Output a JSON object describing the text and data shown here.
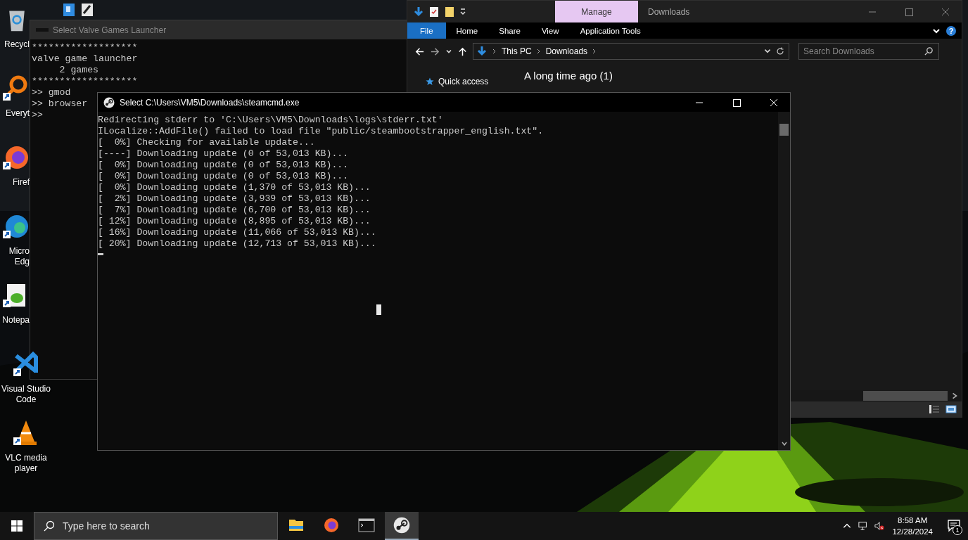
{
  "desktop_icons": [
    {
      "kind": "recycle-bin",
      "label": "Recycl"
    },
    {
      "kind": "everything",
      "label": "Everyt"
    },
    {
      "kind": "firefox",
      "label": "Firef"
    },
    {
      "kind": "edge",
      "label": "Micro Edg"
    },
    {
      "kind": "notepad",
      "label": "Notepa"
    },
    {
      "kind": "vscode",
      "label": "Visual Studio Code"
    },
    {
      "kind": "vlc",
      "label": "VLC media player"
    }
  ],
  "launcher_window": {
    "title": "Select Valve Games Launcher",
    "lines": [
      "*******************",
      "valve game launcher",
      "     2 games",
      "*******************",
      ">> gmod",
      ">> browser",
      ">>"
    ]
  },
  "explorer_window": {
    "context_tab": "Manage",
    "title": "Downloads",
    "ribbon_tabs": [
      {
        "label": "File",
        "selected": true
      },
      {
        "label": "Home",
        "selected": false
      },
      {
        "label": "Share",
        "selected": false
      },
      {
        "label": "View",
        "selected": false
      },
      {
        "label": "Application Tools",
        "selected": false
      }
    ],
    "help": "?",
    "breadcrumb": [
      "This PC",
      "Downloads"
    ],
    "search": {
      "placeholder": "Search Downloads"
    },
    "nav_items": [
      "Quick access"
    ],
    "group_heading": "A long time ago (1)"
  },
  "steamcmd_window": {
    "title": "Select C:\\Users\\VM5\\Downloads\\steamcmd.exe",
    "lines": [
      "Redirecting stderr to 'C:\\Users\\VM5\\Downloads\\logs\\stderr.txt'",
      "ILocalize::AddFile() failed to load file \"public/steambootstrapper_english.txt\".",
      "[  0%] Checking for available update...",
      "[----] Downloading update (0 of 53,013 KB)...",
      "[  0%] Downloading update (0 of 53,013 KB)...",
      "[  0%] Downloading update (0 of 53,013 KB)...",
      "[  0%] Downloading update (1,370 of 53,013 KB)...",
      "[  2%] Downloading update (3,939 of 53,013 KB)...",
      "[  7%] Downloading update (6,700 of 53,013 KB)...",
      "[ 12%] Downloading update (8,895 of 53,013 KB)...",
      "[ 16%] Downloading update (11,066 of 53,013 KB)...",
      "[ 20%] Downloading update (12,713 of 53,013 KB)..."
    ]
  },
  "taskbar": {
    "search": {
      "placeholder": "Type here to search"
    },
    "apps": [
      {
        "kind": "explorer",
        "selected": false
      },
      {
        "kind": "firefox",
        "selected": false
      },
      {
        "kind": "terminal",
        "selected": false
      },
      {
        "kind": "steam",
        "selected": true
      }
    ],
    "time": "8:58 AM",
    "date": "12/28/2024",
    "notification_count": "1"
  }
}
